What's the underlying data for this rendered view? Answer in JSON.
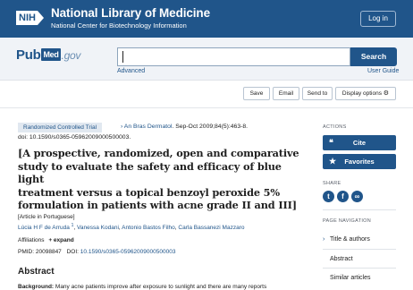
{
  "header": {
    "logo_text": "NIH",
    "title": "National Library of Medicine",
    "subtitle": "National Center for Biotechnology Information",
    "login_label": "Log in"
  },
  "search": {
    "logo_pub": "Pub",
    "logo_med": "Med",
    "logo_gov": ".gov",
    "value": "",
    "button_label": "Search",
    "advanced_label": "Advanced",
    "guide_label": "User Guide"
  },
  "toolbar": {
    "save_label": "Save",
    "email_label": "Email",
    "send_label": "Send to",
    "display_label": "Display options"
  },
  "article": {
    "type_badge": "Randomized Controlled Trial",
    "journal_arrow": "›",
    "journal": "An Bras Dermatol",
    "citation": ". Sep-Oct 2009;84(5):463-8.",
    "doi_line": "doi: 10.1590/s0365-05962009000500003.",
    "title_lines": [
      "[A prospective, randomized, open and comparative",
      "study to evaluate the safety and efficacy of blue light",
      "treatment versus a topical benzoyl peroxide 5%",
      "formulation in patients with acne grade II and III]"
    ],
    "language_note": "[Article in Portuguese]",
    "authors": [
      {
        "name": "Lúcia H F de Arruda",
        "sup": "1"
      },
      {
        "name": "Vanessa Kodani",
        "sup": ""
      },
      {
        "name": "Antonio Bastos Filho",
        "sup": ""
      },
      {
        "name": "Carla Bassanezi Mazzaro",
        "sup": ""
      }
    ],
    "affiliations_label": "Affiliations",
    "expand_label": "+ expand",
    "pmid_label": "PMID:",
    "pmid": "20098847",
    "doi_label": "DOI:",
    "doi": "10.1590/s0365-05962009000500003",
    "abstract_heading": "Abstract",
    "abstract_label": "Background:",
    "abstract_text": "Many acne patients improve after exposure to sunlight and there are many reports"
  },
  "sidebar": {
    "actions_label": "ACTIONS",
    "cite_label": "Cite",
    "favorites_label": "Favorites",
    "share_label": "SHARE",
    "share_icons": [
      "twitter-icon",
      "facebook-icon",
      "permalink-icon"
    ],
    "page_nav_label": "PAGE NAVIGATION",
    "nav_items": [
      {
        "label": "Title & authors",
        "chevron": true
      },
      {
        "label": "Abstract",
        "chevron": false
      },
      {
        "label": "Similar articles",
        "chevron": false
      }
    ]
  },
  "colors": {
    "nih_blue": "#20558a",
    "search_bg": "#f0f3f7",
    "link_blue": "#20558a"
  }
}
